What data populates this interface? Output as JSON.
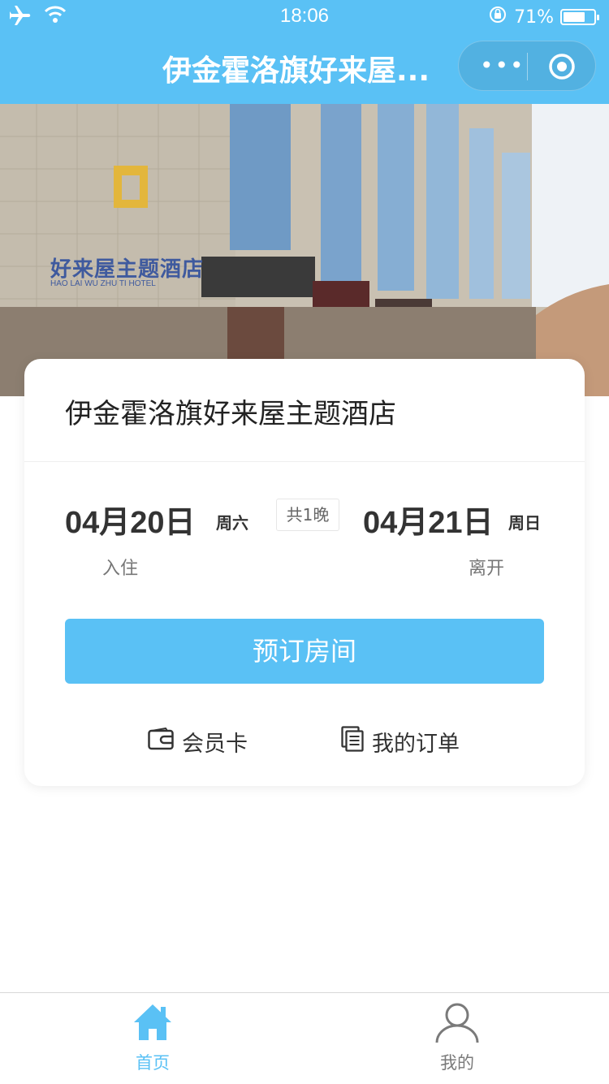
{
  "status_bar": {
    "time": "18:06",
    "battery_percent": "71%",
    "battery_level": 0.71
  },
  "nav": {
    "title": "伊金霍洛旗好来屋..."
  },
  "hero": {
    "sign_text": "好来屋主题酒店",
    "sign_latin": "HAO LAI WU ZHU TI HOTEL"
  },
  "hotel": {
    "name": "伊金霍洛旗好来屋主题酒店"
  },
  "stay": {
    "checkin_date": "04月20日",
    "checkin_weekday": "周六",
    "checkin_label": "入住",
    "nights": "共1晚",
    "checkout_date": "04月21日",
    "checkout_weekday": "周日",
    "checkout_label": "离开"
  },
  "actions": {
    "book_button": "预订房间",
    "member_card": "会员卡",
    "my_orders": "我的订单"
  },
  "tabbar": [
    {
      "label": "首页",
      "active": true
    },
    {
      "label": "我的",
      "active": false
    }
  ],
  "colors": {
    "accent": "#5ac1f5",
    "inactive": "#7a7a7a"
  }
}
